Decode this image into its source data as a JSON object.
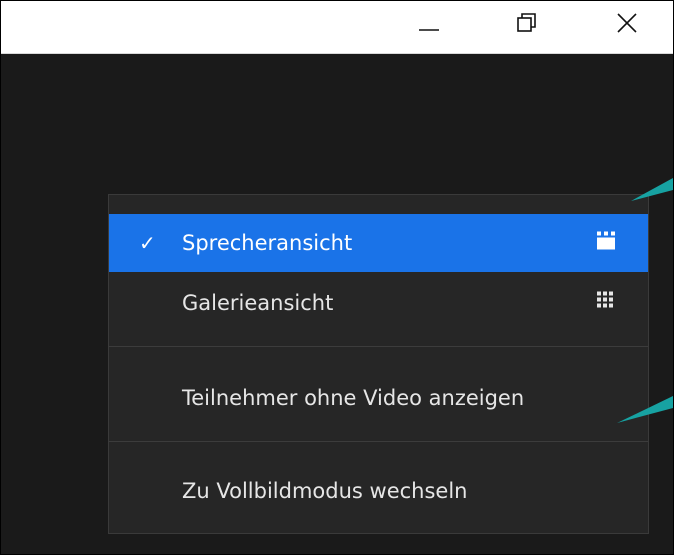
{
  "window": {
    "controls": {
      "minimize_icon": "minimize-icon",
      "restore_icon": "restore-icon",
      "close_icon": "close-icon"
    }
  },
  "menu": {
    "items": [
      {
        "label": "Sprecheransicht",
        "checked": true,
        "icon": "speaker-view-icon",
        "highlighted": true
      },
      {
        "label": "Galerieansicht",
        "checked": false,
        "icon": "gallery-grid-icon",
        "highlighted": false
      },
      {
        "label": "Teilnehmer ohne Video anzeigen",
        "checked": false
      },
      {
        "label": "Zu Vollbildmodus wechseln",
        "checked": false
      }
    ],
    "check_glyph": "✓"
  },
  "colors": {
    "highlight": "#1a73e8",
    "menu_bg": "#262626",
    "window_bg": "#1a1a1a",
    "callout_arrow": "#17a2a2"
  }
}
